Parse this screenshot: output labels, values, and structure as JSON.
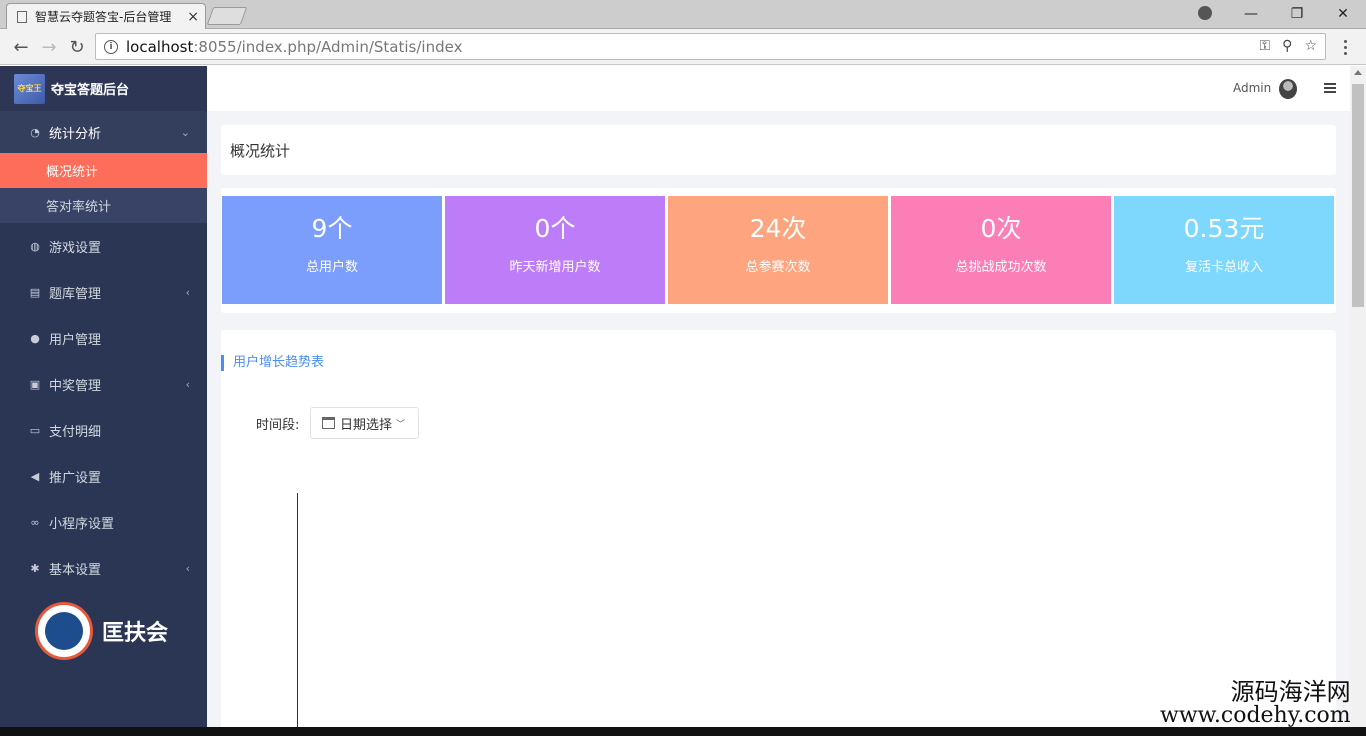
{
  "browser": {
    "tab_title": "智慧云夺题答宝-后台管理",
    "tab_close": "×",
    "url_host": "localhost",
    "url_path": ":8055/index.php/Admin/Statis/index",
    "win_min": "—",
    "win_max": "❐",
    "win_close": "✕"
  },
  "sidebar": {
    "brand": "夺宝答题后台",
    "brand_logo_text": "夺宝王",
    "items": [
      {
        "label": "统计分析",
        "icon": "pie-icon",
        "glyph": "◔",
        "arrow": "⌄"
      },
      {
        "label": "概况统计"
      },
      {
        "label": "答对率统计"
      },
      {
        "label": "游戏设置",
        "icon": "gamepad-icon",
        "glyph": "◍"
      },
      {
        "label": "题库管理",
        "icon": "list-icon",
        "glyph": "▤",
        "arrow": "‹"
      },
      {
        "label": "用户管理",
        "icon": "user-icon",
        "glyph": "●"
      },
      {
        "label": "中奖管理",
        "icon": "award-icon",
        "glyph": "▣",
        "arrow": "‹"
      },
      {
        "label": "支付明细",
        "icon": "card-icon",
        "glyph": "▭"
      },
      {
        "label": "推广设置",
        "icon": "megaphone-icon",
        "glyph": "◀"
      },
      {
        "label": "小程序设置",
        "icon": "link-icon",
        "glyph": "∞"
      },
      {
        "label": "基本设置",
        "icon": "gear-icon",
        "glyph": "✱",
        "arrow": "‹"
      }
    ],
    "org_name": "匡扶会"
  },
  "topbar": {
    "admin_name": "Admin"
  },
  "page": {
    "title": "概况统计"
  },
  "stats": [
    {
      "value": "9个",
      "label": "总用户数",
      "color": "#7b9dfc"
    },
    {
      "value": "0个",
      "label": "昨天新增用户数",
      "color": "#bd7df9"
    },
    {
      "value": "24次",
      "label": "总参赛次数",
      "color": "#fea57f"
    },
    {
      "value": "0次",
      "label": "总挑战成功次数",
      "color": "#fc7eb6"
    },
    {
      "value": "0.53元",
      "label": "复活卡总收入",
      "color": "#7ed7fc"
    }
  ],
  "chart": {
    "heading": "用户增长趋势表",
    "period_label": "时间段:",
    "date_picker": "日期选择",
    "accent": "#4b8ef1"
  },
  "watermark": {
    "line1": "源码海洋网",
    "line2": "www.codehy.com"
  }
}
